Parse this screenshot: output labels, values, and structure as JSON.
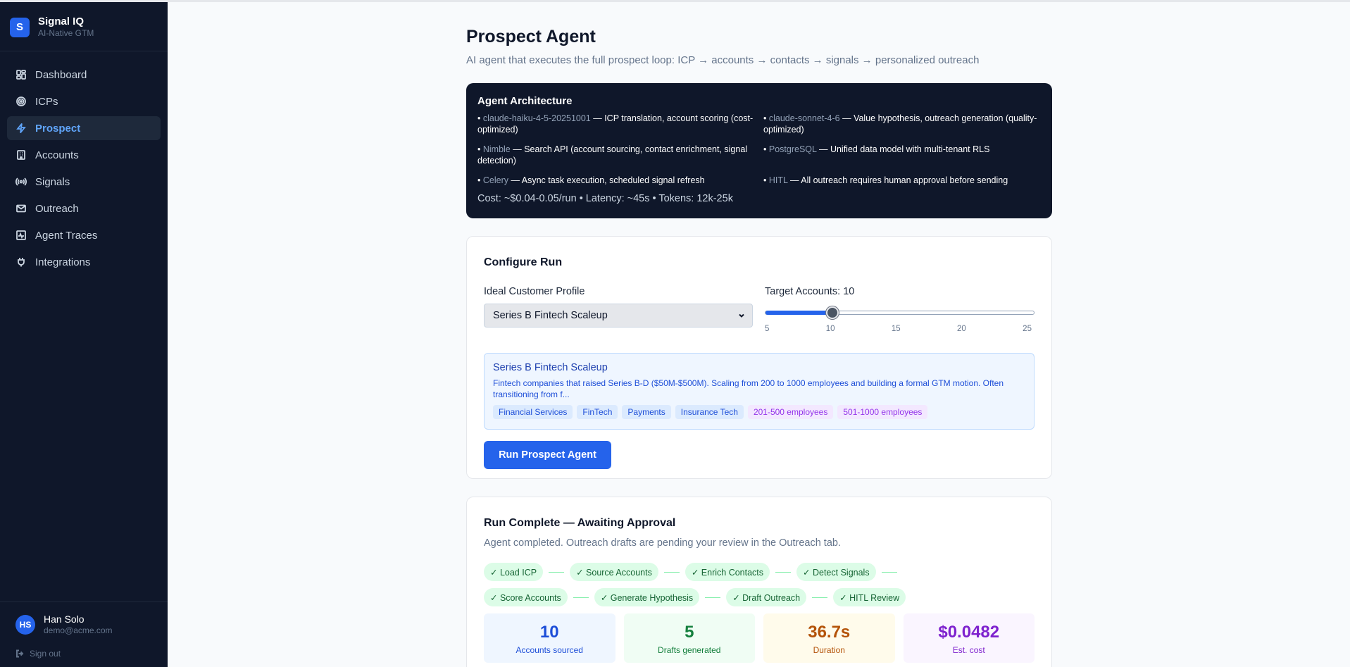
{
  "brand": {
    "logo_letter": "S",
    "name": "Signal IQ",
    "tagline": "AI-Native GTM"
  },
  "nav": [
    {
      "label": "Dashboard",
      "icon": "dashboard-icon"
    },
    {
      "label": "ICPs",
      "icon": "target-icon"
    },
    {
      "label": "Prospect",
      "icon": "lightning-icon",
      "active": true
    },
    {
      "label": "Accounts",
      "icon": "building-icon"
    },
    {
      "label": "Signals",
      "icon": "broadcast-icon"
    },
    {
      "label": "Outreach",
      "icon": "mail-icon"
    },
    {
      "label": "Agent Traces",
      "icon": "activity-icon"
    },
    {
      "label": "Integrations",
      "icon": "plug-icon"
    }
  ],
  "user": {
    "initials": "HS",
    "name": "Han Solo",
    "email": "demo@acme.com",
    "signout": "Sign out"
  },
  "page": {
    "title": "Prospect Agent",
    "subtitle": "AI agent that executes the full prospect loop: ICP → accounts → contacts → signals → personalized outreach"
  },
  "architecture": {
    "title": "Agent Architecture",
    "items": [
      {
        "name": "claude-haiku-4-5-20251001",
        "desc": " — ICP translation, account scoring (cost-optimized)"
      },
      {
        "name": "claude-sonnet-4-6",
        "desc": " — Value hypothesis, outreach generation (quality-optimized)"
      },
      {
        "name": "Nimble",
        "desc": " — Search API (account sourcing, contact enrichment, signal detection)"
      },
      {
        "name": "PostgreSQL",
        "desc": " — Unified data model with multi-tenant RLS"
      },
      {
        "name": "Celery",
        "desc": " — Async task execution, scheduled signal refresh"
      },
      {
        "name": "HITL",
        "desc": " — All outreach requires human approval before sending"
      }
    ],
    "cost_line": "Cost: ~$0.04-0.05/run • Latency: ~45s • Tokens: 12k-25k"
  },
  "config": {
    "title": "Configure Run",
    "icp_label": "Ideal Customer Profile",
    "icp_selected": "Series B Fintech Scaleup",
    "target_label": "Target Accounts: 10",
    "slider": {
      "min": 5,
      "max": 25,
      "value": 10,
      "ticks": [
        "5",
        "10",
        "15",
        "20",
        "25"
      ]
    },
    "icp_preview": {
      "name": "Series B Fintech Scaleup",
      "description": "Fintech companies that raised Series B-D ($50M-$500M). Scaling from 200 to 1000 employees and building a formal GTM motion. Often transitioning from f...",
      "industries": [
        "Financial Services",
        "FinTech",
        "Payments",
        "Insurance Tech"
      ],
      "sizes": [
        "201-500 employees",
        "501-1000 employees"
      ]
    },
    "run_button": "Run Prospect Agent"
  },
  "run": {
    "title": "Run Complete — Awaiting Approval",
    "subtitle": "Agent completed. Outreach drafts are pending your review in the Outreach tab.",
    "steps_row1": [
      "✓ Load ICP",
      "✓ Source Accounts",
      "✓ Enrich Contacts",
      "✓ Detect Signals"
    ],
    "steps_row2": [
      "✓ Score Accounts",
      "✓ Generate Hypothesis",
      "✓ Draft Outreach",
      "✓ HITL Review"
    ],
    "stats": [
      {
        "value": "10",
        "label": "Accounts sourced",
        "bg": "#eff6ff",
        "color": "#1d4ed8"
      },
      {
        "value": "5",
        "label": "Drafts generated",
        "bg": "#f0fdf4",
        "color": "#15803d"
      },
      {
        "value": "36.7s",
        "label": "Duration",
        "bg": "#fffbeb",
        "color": "#b45309"
      },
      {
        "value": "$0.0482",
        "label": "Est. cost",
        "bg": "#faf5ff",
        "color": "#7e22ce"
      }
    ]
  }
}
